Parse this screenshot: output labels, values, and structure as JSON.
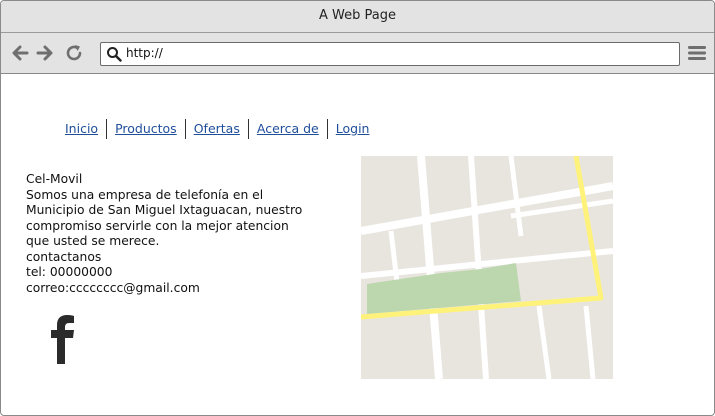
{
  "window": {
    "title": "A Web Page"
  },
  "toolbar": {
    "url": "http://",
    "icons": [
      "back-arrow-icon",
      "forward-arrow-icon",
      "reload-icon",
      "search-icon",
      "hamburger-menu-icon"
    ]
  },
  "nav": {
    "links": [
      {
        "label": "Inicio"
      },
      {
        "label": "Productos"
      },
      {
        "label": "Ofertas"
      },
      {
        "label": "Acerca de"
      },
      {
        "label": "Login"
      }
    ]
  },
  "info": {
    "lines": [
      "Cel-Movil",
      "Somos una empresa de telefonía en el",
      "Municipio de San Miguel Ixtaguacan, nuestro",
      "compromiso servirle con la mejor atencion",
      "que usted se merece.",
      "contactanos",
      "tel: 00000000",
      "correo:cccccccc@gmail.com"
    ]
  },
  "social": {
    "icon": "facebook-icon"
  },
  "map": {
    "icon": "map-image",
    "colors": {
      "land": "#e8e5df",
      "road": "#ffffff",
      "highlight": "#fff27a",
      "park": "#bcd7ae"
    }
  }
}
